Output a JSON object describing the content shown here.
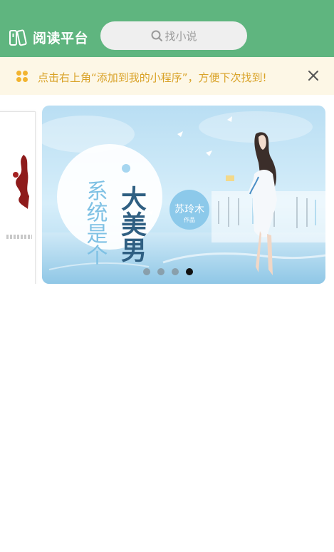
{
  "header": {
    "title": "阅读平台",
    "search_placeholder": "找小说",
    "background": "#5fb57f"
  },
  "notice": {
    "text": "点击右上角“添加到我的小程序”，方便下次找到!",
    "text_color": "#d9a227",
    "background": "#fdf7e6",
    "icon": "grid-dots-icon",
    "close_icon": "close-icon"
  },
  "carousel": {
    "slide_count": 4,
    "active_index": 3,
    "current_slide": {
      "title_left": "系统是个",
      "title_right": "大美男",
      "author": "苏玲木",
      "author_note": "作品"
    }
  }
}
